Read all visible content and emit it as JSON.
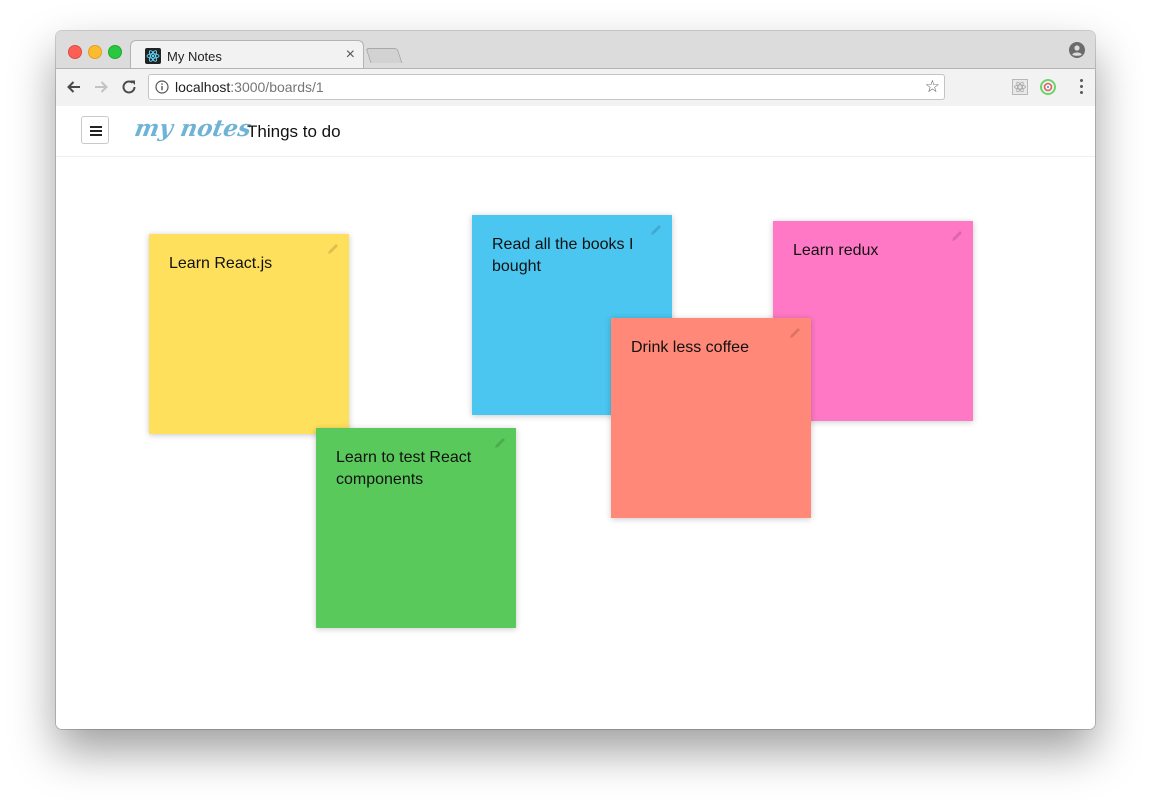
{
  "browser": {
    "tab": {
      "title": "My Notes",
      "close_label": "×"
    },
    "omnibox": {
      "url_host": "localhost",
      "url_rest": ":3000/boards/1"
    }
  },
  "app": {
    "logo": "my notes",
    "board_title": "Things to do",
    "notes": [
      {
        "text": "Learn React.js",
        "color": "#ffe05c"
      },
      {
        "text": "Learn to test React components",
        "color": "#58c95a"
      },
      {
        "text": "Read all the books I bought",
        "color": "#4ac6f0"
      },
      {
        "text": "Learn redux",
        "color": "#ff78c6"
      },
      {
        "text": "Drink less coffee",
        "color": "#ff8878"
      }
    ]
  },
  "colors": {
    "accent": "#6fb3d6"
  }
}
